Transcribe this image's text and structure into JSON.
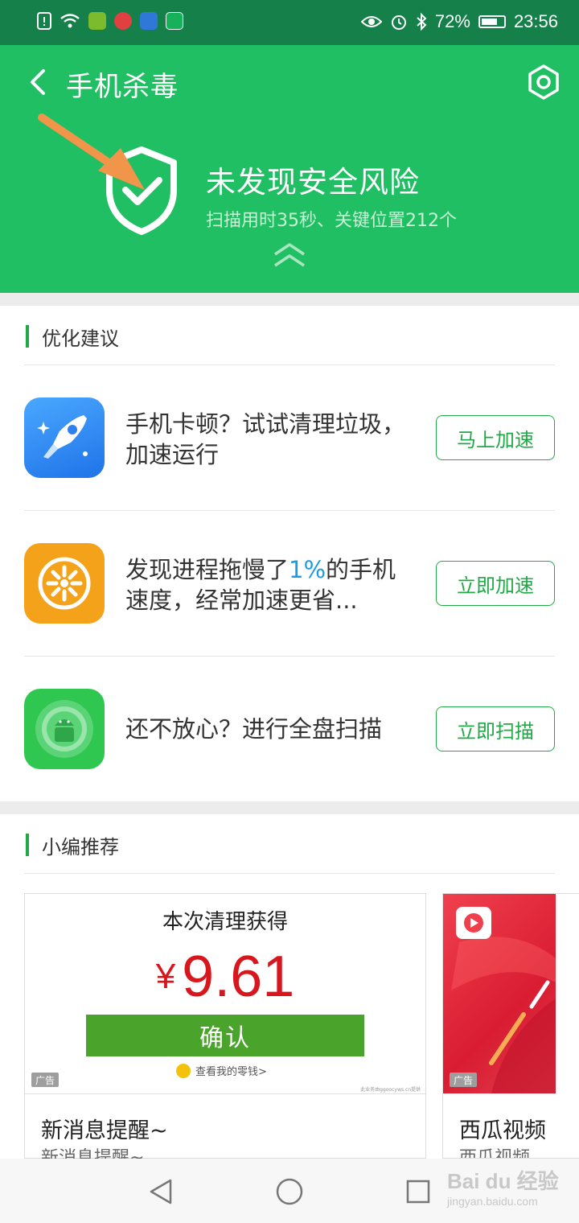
{
  "status_bar": {
    "battery": "72%",
    "time": "23:56",
    "battery_level": 0.72
  },
  "header": {
    "title": "手机杀毒",
    "scan_status": "未发现安全风险",
    "scan_detail": "扫描用时35秒、关键位置212个"
  },
  "optimize": {
    "section_title": "优化建议",
    "items": [
      {
        "text": "手机卡顿？试试清理垃圾，加速运行",
        "button": "马上加速"
      },
      {
        "text_before": "发现进程拖慢了",
        "highlight": "1%",
        "text_after": "的手机速度，经常加速更省...",
        "button": "立即加速"
      },
      {
        "text": "还不放心？进行全盘扫描",
        "button": "立即扫描"
      }
    ]
  },
  "recommend": {
    "section_title": "小编推荐",
    "cards": [
      {
        "reward_title": "本次清理获得",
        "currency": "¥",
        "amount": "9.61",
        "confirm": "确认",
        "link": "查看我的零钱>",
        "ad": "广告",
        "credit": "此业务由ggoocyws.cn提供",
        "title": "新消息提醒~",
        "subtitle": "新消息提醒~"
      },
      {
        "ad": "广告",
        "title": "西瓜视频",
        "subtitle": "西瓜视频"
      }
    ]
  },
  "watermark": {
    "logo": "Bai du 经验",
    "url": "jingyan.baidu.com"
  },
  "colors": {
    "primary_green": "#21bf63",
    "status_bar": "#15804a",
    "button_green": "#21a847",
    "highlight_blue": "#1a9be6",
    "price_red": "#d8161d"
  }
}
